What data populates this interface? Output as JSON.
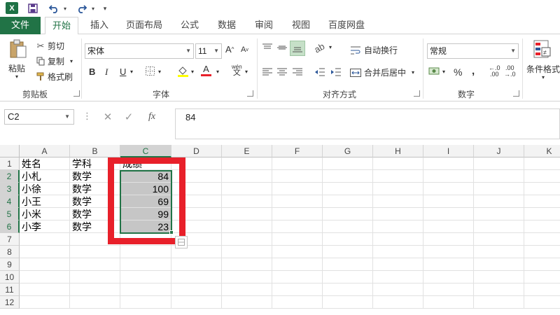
{
  "quick_access": {
    "app_icon": "X",
    "save_icon": "save-icon",
    "undo_icon": "undo-icon",
    "redo_icon": "redo-icon"
  },
  "tabs": [
    {
      "label": "文件"
    },
    {
      "label": "开始"
    },
    {
      "label": "插入"
    },
    {
      "label": "页面布局"
    },
    {
      "label": "公式"
    },
    {
      "label": "数据"
    },
    {
      "label": "审阅"
    },
    {
      "label": "视图"
    },
    {
      "label": "百度网盘"
    }
  ],
  "ribbon": {
    "clipboard": {
      "paste": "粘贴",
      "cut": "剪切",
      "copy": "复制",
      "format_painter": "格式刷",
      "group": "剪贴板"
    },
    "font": {
      "name": "宋体",
      "size": "11",
      "group": "字体",
      "phonetic": "wén"
    },
    "alignment": {
      "wrap": "自动换行",
      "merge": "合并后居中",
      "group": "对齐方式"
    },
    "number": {
      "format": "常规",
      "group": "数字"
    },
    "styles": {
      "conditional": "条件格式"
    }
  },
  "formula_bar": {
    "name_box": "C2",
    "formula": "84",
    "fx": "fx"
  },
  "columns": [
    "A",
    "B",
    "C",
    "D",
    "E",
    "F",
    "G",
    "H",
    "I",
    "J",
    "K"
  ],
  "rows": [
    "1",
    "2",
    "3",
    "4",
    "5",
    "6",
    "7",
    "8",
    "9",
    "10",
    "11",
    "12"
  ],
  "table": {
    "headers": [
      "姓名",
      "学科",
      "成绩"
    ],
    "records": [
      {
        "name": "小札",
        "subject": "数学",
        "score": "84"
      },
      {
        "name": "小徐",
        "subject": "数学",
        "score": "100"
      },
      {
        "name": "小王",
        "subject": "数学",
        "score": "69"
      },
      {
        "name": "小米",
        "subject": "数学",
        "score": "99"
      },
      {
        "name": "小李",
        "subject": "数学",
        "score": "23"
      }
    ]
  },
  "colors": {
    "accent": "#217346",
    "highlight": "#e8202a",
    "selection_fill": "#c6c6c6"
  }
}
